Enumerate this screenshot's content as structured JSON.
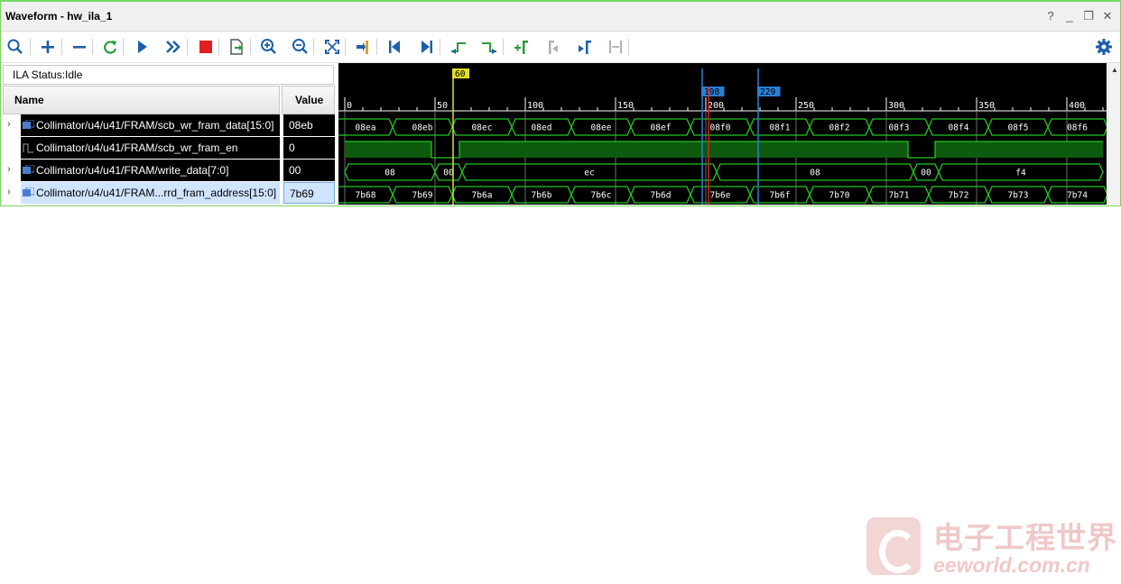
{
  "window": {
    "title": "Waveform - hw_ila_1",
    "controls": [
      "?",
      "_",
      "❐",
      "✕"
    ]
  },
  "toolbar": {
    "buttons": [
      {
        "name": "search-icon",
        "icon": "search",
        "color": "#1d5fa8"
      },
      {
        "name": "add-icon",
        "icon": "plus",
        "color": "#1d5fa8"
      },
      {
        "name": "remove-icon",
        "icon": "minus",
        "color": "#1d5fa8"
      },
      {
        "name": "refresh-icon",
        "icon": "refresh",
        "color": "#2a9a3a"
      },
      {
        "name": "run-trigger-icon",
        "icon": "play",
        "color": "#1d5fa8"
      },
      {
        "name": "run-immediate-icon",
        "icon": "fast-forward",
        "color": "#1d5fa8"
      },
      {
        "name": "stop-icon",
        "icon": "stop",
        "color": "#e02020"
      },
      {
        "name": "export-icon",
        "icon": "export",
        "color": "#2a9a3a"
      },
      {
        "name": "zoom-in-icon",
        "icon": "zoom-in",
        "color": "#1d5fa8"
      },
      {
        "name": "zoom-out-icon",
        "icon": "zoom-out",
        "color": "#1d5fa8"
      },
      {
        "name": "zoom-fit-icon",
        "icon": "zoom-fit",
        "color": "#1d5fa8"
      },
      {
        "name": "go-to-cursor-icon",
        "icon": "cursor-goto",
        "color": "#1d5fa8"
      },
      {
        "name": "go-to-start-icon",
        "icon": "first",
        "color": "#1d5fa8"
      },
      {
        "name": "go-to-end-icon",
        "icon": "last",
        "color": "#1d5fa8"
      },
      {
        "name": "previous-transition-icon",
        "icon": "prev-transition",
        "color": "#2a9a3a"
      },
      {
        "name": "next-transition-icon",
        "icon": "next-transition",
        "color": "#2a9a3a"
      },
      {
        "name": "add-marker-icon",
        "icon": "add-marker",
        "color": "#2a9a3a"
      },
      {
        "name": "previous-marker-icon",
        "icon": "prev-marker",
        "color": "#b0b0b0"
      },
      {
        "name": "next-marker-icon",
        "icon": "next-marker",
        "color": "#1d5fa8"
      },
      {
        "name": "swap-cursors-icon",
        "icon": "swap",
        "color": "#b0b0b0"
      }
    ],
    "settings_icon": "gear-icon",
    "accent": "#1d5fa8"
  },
  "status": {
    "text": "ILA Status:Idle"
  },
  "columns": {
    "name": "Name",
    "value": "Value"
  },
  "signals": [
    {
      "name": "Collimator/u4/u41/FRAM/scb_wr_fram_data[15:0]",
      "value": "08eb",
      "type": "bus",
      "expandable": true,
      "selected": false
    },
    {
      "name": "Collimator/u4/u41/FRAM/scb_wr_fram_en",
      "value": "0",
      "type": "bit",
      "expandable": false,
      "selected": false
    },
    {
      "name": "Collimator/u4/u41/FRAM/write_data[7:0]",
      "value": "00",
      "type": "bus",
      "expandable": true,
      "selected": false
    },
    {
      "name": "Collimator/u4/u41/FRAM...rrd_fram_address[15:0]",
      "value": "7b69",
      "type": "bus",
      "expandable": true,
      "selected": true
    }
  ],
  "chart_data": {
    "type": "waveform",
    "xlim": [
      0,
      420
    ],
    "major_ticks": [
      0,
      50,
      100,
      150,
      200,
      250,
      300,
      350,
      400
    ],
    "minor_tick_step": 10,
    "cursors": [
      {
        "label": "60",
        "x": 60,
        "color": "#e0e020"
      },
      {
        "label": "198",
        "x": 198,
        "color": "#2a7fd4"
      },
      {
        "label": "229",
        "x": 229,
        "color": "#2a7fd4"
      }
    ],
    "red_cursor_x": 198,
    "bus_signal_0": {
      "start": -6.5,
      "period": 33,
      "label_color": "#ffffff",
      "labels": [
        "08ea",
        "08eb",
        "08ec",
        "08ed",
        "08ee",
        "08ef",
        "08f0",
        "08f1",
        "08f2",
        "08f3",
        "08f4",
        "08f5",
        "08f6"
      ]
    },
    "bit_signal_1": {
      "segments": [
        [
          0,
          48,
          1
        ],
        [
          48,
          63.5,
          0
        ],
        [
          63.5,
          312,
          1
        ],
        [
          312,
          327,
          0
        ],
        [
          327,
          420,
          1
        ]
      ]
    },
    "bus_signal_2": {
      "segments": [
        [
          0,
          50,
          "08"
        ],
        [
          50,
          65,
          "00"
        ],
        [
          65,
          206,
          "ec"
        ],
        [
          206,
          315,
          "08"
        ],
        [
          315,
          329,
          "00"
        ],
        [
          329,
          420,
          "f4"
        ]
      ]
    },
    "bus_signal_3": {
      "start": -6.5,
      "period": 33,
      "labels": [
        "7b68",
        "7b69",
        "7b6a",
        "7b6b",
        "7b6c",
        "7b6d",
        "7b6e",
        "7b6f",
        "7b70",
        "7b71",
        "7b72",
        "7b73",
        "7b74"
      ]
    },
    "wave_color": "#22c522",
    "fill_color": "#0e5a0e"
  },
  "watermark": {
    "cn": "电子工程世界",
    "en": "eeworld.com.cn"
  }
}
